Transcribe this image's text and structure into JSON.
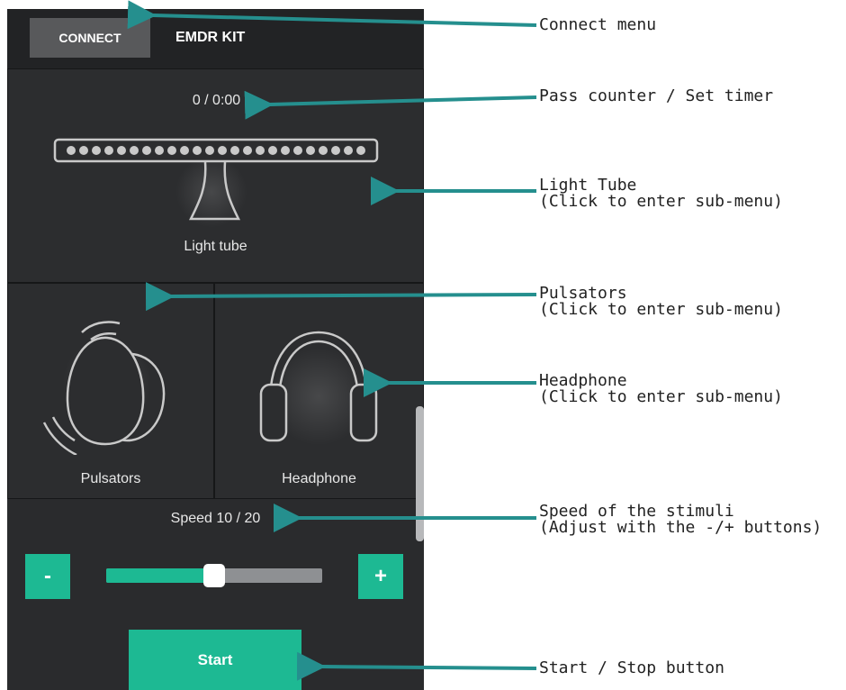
{
  "colors": {
    "accent": "#1db993",
    "background": "#2a2b2d",
    "annotation_arrow": "#258f8e"
  },
  "header": {
    "connect_label": "CONNECT",
    "app_title": "EMDR KIT"
  },
  "light_tube": {
    "counter": "0 / 0:00",
    "label": "Light tube",
    "icon": "light-tube-icon"
  },
  "pulsators": {
    "label": "Pulsators",
    "icon": "pulsators-icon"
  },
  "headphone": {
    "label": "Headphone",
    "icon": "headphone-icon"
  },
  "speed": {
    "label": "Speed 10 / 20",
    "value": 10,
    "max": 20,
    "minus_label": "-",
    "plus_label": "+"
  },
  "start_label": "Start",
  "annotations": [
    {
      "line1": "Connect menu",
      "line2": ""
    },
    {
      "line1": "Pass counter / Set timer",
      "line2": ""
    },
    {
      "line1": "Light Tube",
      "line2": "(Click to enter sub-menu)"
    },
    {
      "line1": "Pulsators",
      "line2": "(Click to enter sub-menu)"
    },
    {
      "line1": "Headphone",
      "line2": "(Click to enter sub-menu)"
    },
    {
      "line1": "Speed of the stimuli",
      "line2": "(Adjust with the -/+ buttons)"
    },
    {
      "line1": "Start / Stop button",
      "line2": ""
    }
  ]
}
